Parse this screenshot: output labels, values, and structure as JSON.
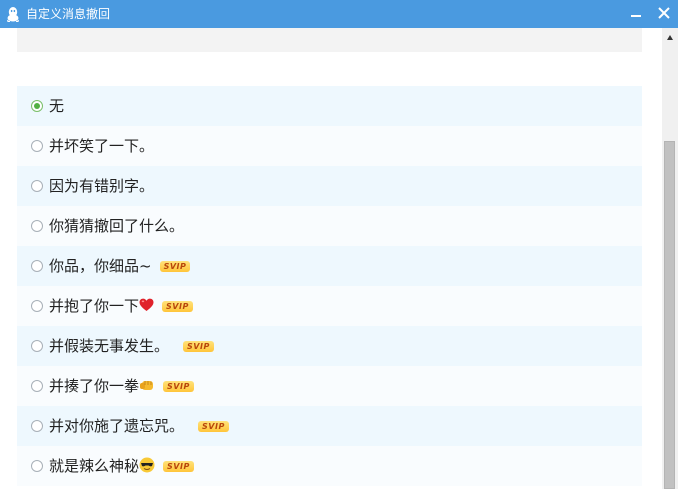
{
  "window": {
    "title": "自定义消息撤回",
    "title_bar_color": "#4a9ae0",
    "app_icon": "qq-penguin-icon",
    "minimize_icon": "minimize-icon",
    "close_icon": "close-icon"
  },
  "options": [
    {
      "label": "无",
      "selected": true,
      "svip": false,
      "emoji": ""
    },
    {
      "label": "并坏笑了一下。",
      "selected": false,
      "svip": false,
      "emoji": ""
    },
    {
      "label": "因为有错别字。",
      "selected": false,
      "svip": false,
      "emoji": ""
    },
    {
      "label": "你猜猜撤回了什么。",
      "selected": false,
      "svip": false,
      "emoji": ""
    },
    {
      "label": "你品，你细品~",
      "selected": false,
      "svip": true,
      "emoji": ""
    },
    {
      "label": "并抱了你一下",
      "selected": false,
      "svip": true,
      "emoji": "red-heart-emoji"
    },
    {
      "label": "并假装无事发生。",
      "selected": false,
      "svip": true,
      "emoji": ""
    },
    {
      "label": "并揍了你一拳",
      "selected": false,
      "svip": true,
      "emoji": "punch-fist-emoji"
    },
    {
      "label": "并对你施了遗忘咒。",
      "selected": false,
      "svip": true,
      "emoji": ""
    },
    {
      "label": "就是辣么神秘",
      "selected": false,
      "svip": true,
      "emoji": "cool-sunglasses-emoji"
    }
  ],
  "badge": {
    "svip_label": "SVIP"
  },
  "scroll": {
    "position_fraction": 0.22
  },
  "colors": {
    "selected_radio": "#52b043",
    "row_alt": "#eef8fe",
    "svip_badge": "#ffc53a"
  }
}
